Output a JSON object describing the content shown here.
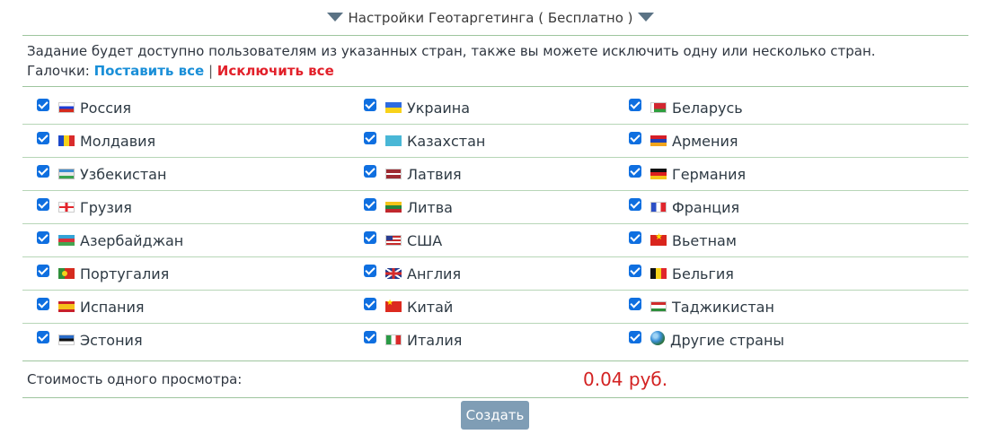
{
  "header": {
    "title": "Настройки Геотаргетинга ( Бесплатно )",
    "left_icon": "triangle-down-icon",
    "right_icon": "triangle-down-icon"
  },
  "description": {
    "text": "Задание будет доступно пользователям из указанных стран, также вы можете исключить одну или несколько стран.",
    "checkboxes_label": "Галочки:",
    "set_all": "Поставить все",
    "separator": "|",
    "exclude_all": "Исключить все"
  },
  "countries": [
    {
      "name": "Россия",
      "flag": "russia-flag-icon",
      "checked": true
    },
    {
      "name": "Украина",
      "flag": "ukraine-flag-icon",
      "checked": true
    },
    {
      "name": "Беларусь",
      "flag": "belarus-flag-icon",
      "checked": true
    },
    {
      "name": "Молдавия",
      "flag": "moldova-flag-icon",
      "checked": true
    },
    {
      "name": "Казахстан",
      "flag": "kazakhstan-flag-icon",
      "checked": true
    },
    {
      "name": "Армения",
      "flag": "armenia-flag-icon",
      "checked": true
    },
    {
      "name": "Узбекистан",
      "flag": "uzbekistan-flag-icon",
      "checked": true
    },
    {
      "name": "Латвия",
      "flag": "latvia-flag-icon",
      "checked": true
    },
    {
      "name": "Германия",
      "flag": "germany-flag-icon",
      "checked": true
    },
    {
      "name": "Грузия",
      "flag": "georgia-flag-icon",
      "checked": true
    },
    {
      "name": "Литва",
      "flag": "lithuania-flag-icon",
      "checked": true
    },
    {
      "name": "Франция",
      "flag": "france-flag-icon",
      "checked": true
    },
    {
      "name": "Азербайджан",
      "flag": "azerbaijan-flag-icon",
      "checked": true
    },
    {
      "name": "США",
      "flag": "usa-flag-icon",
      "checked": true
    },
    {
      "name": "Вьетнам",
      "flag": "vietnam-flag-icon",
      "checked": true
    },
    {
      "name": "Португалия",
      "flag": "portugal-flag-icon",
      "checked": true
    },
    {
      "name": "Англия",
      "flag": "uk-flag-icon",
      "checked": true
    },
    {
      "name": "Бельгия",
      "flag": "belgium-flag-icon",
      "checked": true
    },
    {
      "name": "Испания",
      "flag": "spain-flag-icon",
      "checked": true
    },
    {
      "name": "Китай",
      "flag": "china-flag-icon",
      "checked": true
    },
    {
      "name": "Таджикистан",
      "flag": "tajikistan-flag-icon",
      "checked": true
    },
    {
      "name": "Эстония",
      "flag": "estonia-flag-icon",
      "checked": true
    },
    {
      "name": "Италия",
      "flag": "italy-flag-icon",
      "checked": true
    },
    {
      "name": "Другие страны",
      "flag": "globe-icon",
      "checked": true
    }
  ],
  "cost": {
    "label": "Стоимость одного просмотра:",
    "value": "0.04 руб."
  },
  "create_button": "Создать",
  "colors": {
    "checkbox": "#0f6fe0",
    "set_all_link": "#1a8fd8",
    "exclude_all_link": "#e2202a",
    "price": "#d32222",
    "button": "#7f9db5",
    "divider": "#9ec59e"
  }
}
